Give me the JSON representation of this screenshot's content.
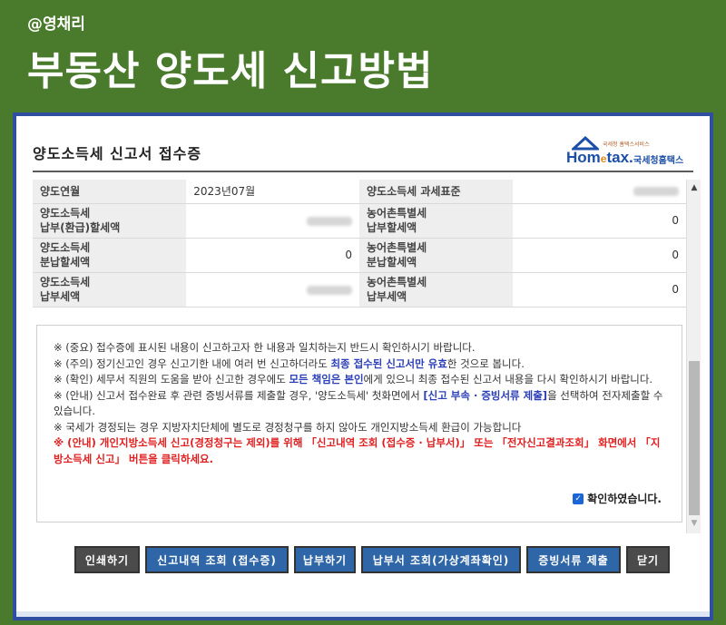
{
  "banner": {
    "handle": "@영채리",
    "title": "부동산 양도세 신고방법"
  },
  "window": {
    "title": "양도소득세 신고서 접수증",
    "logo": {
      "main_pre": "Hom",
      "main_e": "e",
      "main_post": "tax.",
      "korean": "국세청홈택스",
      "subtitle": "국세청 홈택스서비스"
    }
  },
  "table": {
    "rows": [
      {
        "l1": "양도연월",
        "v1": "2023년07월",
        "l2": "양도소득세 과세표준",
        "v2": ""
      },
      {
        "l1": "양도소득세\n납부(환급)할세액",
        "v1": "",
        "l2": "농어촌특별세\n납부할세액",
        "v2": "0"
      },
      {
        "l1": "양도소득세\n분납할세액",
        "v1": "0",
        "l2": "농어촌특별세\n분납할세액",
        "v2": "0"
      },
      {
        "l1": "양도소득세\n납부세액",
        "v1": "",
        "l2": "농어촌특별세\n납부세액",
        "v2": "0"
      }
    ]
  },
  "notice": {
    "line1": "※ (중요) 접수증에 표시된 내용이 신고하고자 한 내용과 일치하는지 반드시 확인하시기 바랍니다.",
    "line2_a": "※ (주의) 정기신고인 경우 신고기한 내에 여러 번 신고하더라도 ",
    "line2_hl": "최종 접수된 신고서만 유효",
    "line2_b": "한 것으로 봅니다.",
    "line3_a": "※ (확인) 세무서 직원의 도움을 받아 신고한 경우에도 ",
    "line3_hl": "모든 책임은 본인",
    "line3_b": "에게 있으니 최종 접수된 신고서 내용을 다시 확인하시기 바랍니다.",
    "line4_a": "※ (안내) 신고서 접수완료 후 관련 증빙서류를 제출할 경우, '양도소득세' 첫화면에서 ",
    "line4_hl": "[신고 부속 · 증빙서류 제출]",
    "line4_b": "을 선택하여 전자제출할 수 있습니다.",
    "line5": "※ 국세가 경정되는 경우 지방자치단체에 별도로 경정청구를 하지 않아도 개인지방소득세 환급이 가능합니다",
    "line6": "※ (안내) 개인지방소득세 신고(경정청구는 제외)를 위해 「신고내역 조회 (접수증 · 납부서)」 또는 「전자신고결과조회」 화면에서 「지방소득세 신고」 버튼을 클릭하세요.",
    "confirm": "확인하였습니다."
  },
  "buttons": {
    "print": "인쇄하기",
    "history": "신고내역 조회 (접수증)",
    "pay": "납부하기",
    "bill": "납부서 조회(가상계좌확인)",
    "evidence": "증빙서류 제출",
    "close": "닫기"
  },
  "colors": {
    "banner": "#4a7a2c",
    "frame": "#2f4fa0",
    "highlight": "#2b3fb8",
    "warning": "#e02020",
    "button_blue": "#2f66a8",
    "button_dark": "#4b4b4b"
  }
}
